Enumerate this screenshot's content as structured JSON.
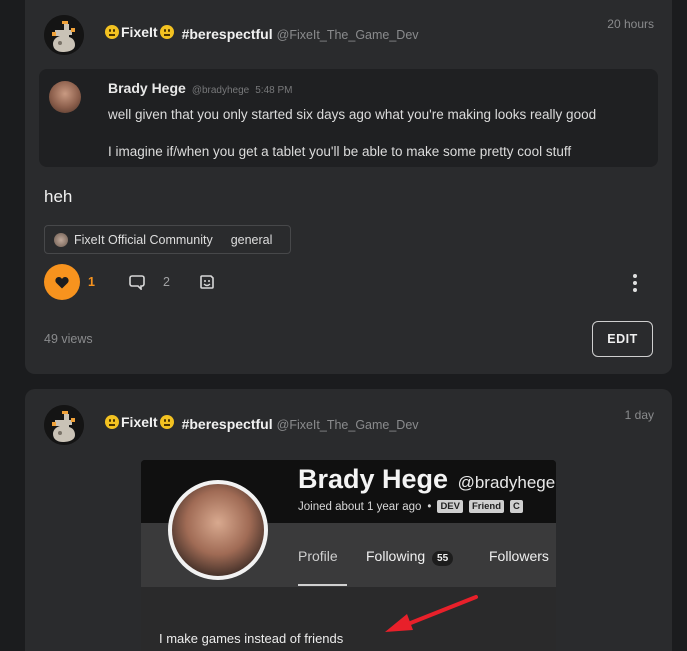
{
  "post1": {
    "author": {
      "display_name": "FixeIt",
      "hashtag": "#berespectful",
      "handle": "@FixeIt_The_Game_Dev",
      "emoji_icon": "neutral-face-emoji"
    },
    "timestamp": "20 hours",
    "quote": {
      "name": "Brady Hege",
      "handle": "@bradyhege",
      "time": "5:48 PM",
      "line1": "well given that you only started six days ago what you're making looks really good",
      "line2": "I imagine if/when you get a tablet you'll be able to make some pretty cool stuff"
    },
    "text": "heh",
    "community": {
      "name": "FixeIt Official Community",
      "channel": "general"
    },
    "actions": {
      "like_count": "1",
      "comment_count": "2"
    },
    "views": "49 views",
    "edit_label": "EDIT"
  },
  "post2": {
    "author": {
      "display_name": "FixeIt",
      "hashtag": "#berespectful",
      "handle": "@FixeIt_The_Game_Dev",
      "emoji_icon": "neutral-face-emoji"
    },
    "timestamp": "1 day",
    "embed": {
      "name": "Brady Hege",
      "handle": "@bradyhege",
      "joined": "Joined about 1 year ago",
      "separator": "•",
      "badges": [
        "DEV",
        "Friend",
        "C"
      ],
      "tabs": {
        "profile": "Profile",
        "following": "Following",
        "following_count": "55",
        "followers": "Followers"
      },
      "bio": "I make games instead of friends"
    }
  },
  "colors": {
    "accent": "#f7931e",
    "background": "#1b1c1e",
    "card": "#2a2b2d",
    "arrow": "#e8202a"
  }
}
